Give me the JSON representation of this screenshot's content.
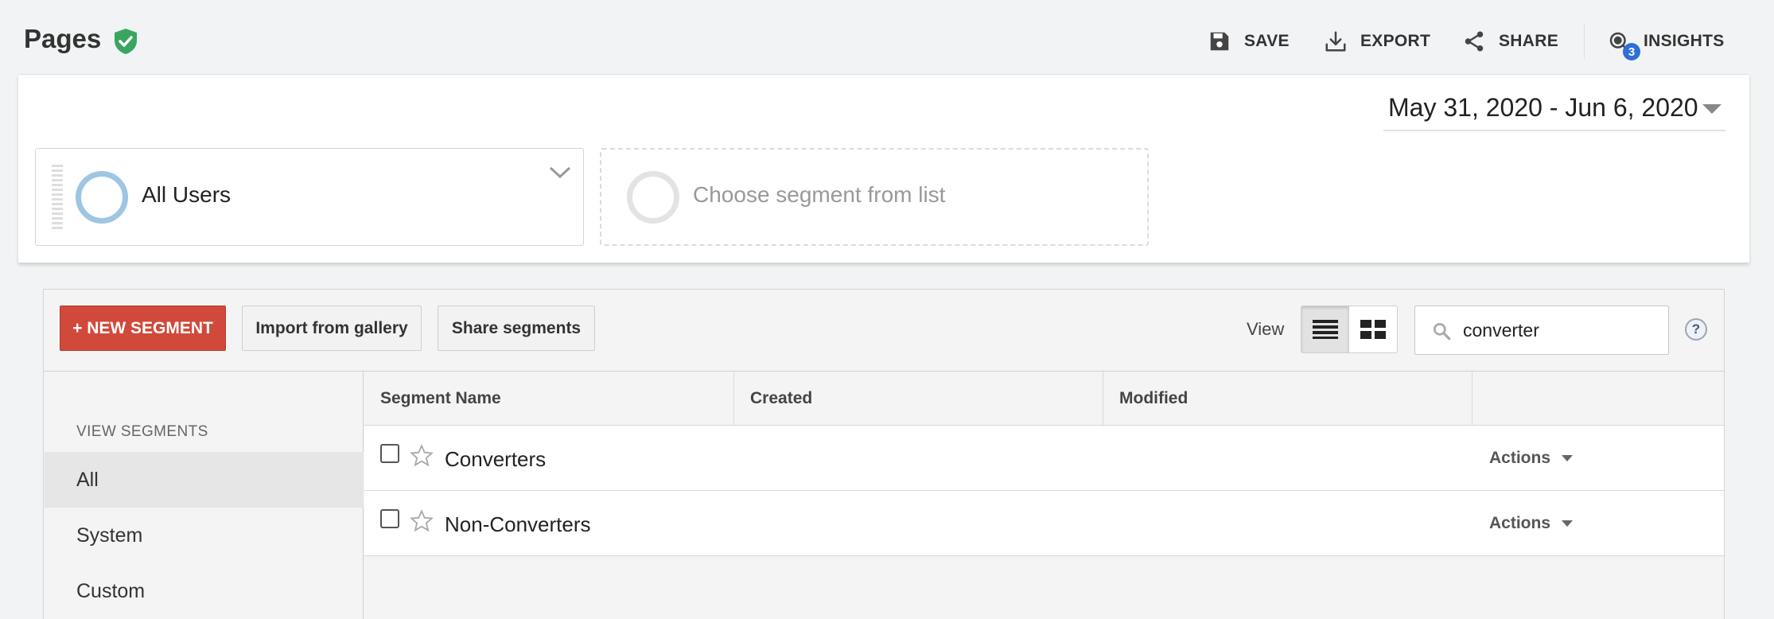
{
  "header": {
    "title": "Pages",
    "save_label": "SAVE",
    "export_label": "EXPORT",
    "share_label": "SHARE",
    "insights_label": "INSIGHTS",
    "insights_count": "3"
  },
  "date_range": "May 31, 2020 - Jun 6, 2020",
  "segments": {
    "active_label": "All Users",
    "empty_label": "Choose segment from list"
  },
  "manager": {
    "new_segment_label": "+ NEW SEGMENT",
    "import_label": "Import from gallery",
    "share_label": "Share segments",
    "view_label": "View",
    "search_value": "converter",
    "help_label": "?"
  },
  "sidebar": {
    "title": "VIEW SEGMENTS",
    "items": [
      {
        "label": "All",
        "selected": true
      },
      {
        "label": "System",
        "selected": false
      },
      {
        "label": "Custom",
        "selected": false
      }
    ]
  },
  "table": {
    "columns": [
      "Segment Name",
      "Created",
      "Modified",
      ""
    ],
    "rows": [
      {
        "name": "Converters",
        "created": "",
        "modified": "",
        "action": "Actions"
      },
      {
        "name": "Non-Converters",
        "created": "",
        "modified": "",
        "action": "Actions"
      }
    ]
  },
  "colors": {
    "new_segment_bg": "#d0493a",
    "shield": "#3aa561",
    "badge": "#2f6fd6",
    "active_ring": "#9ec6e4"
  },
  "icons": {
    "shield": "shield-check-icon",
    "save": "floppy-disk-icon",
    "export": "download-icon",
    "share": "share-nodes-icon",
    "insights": "insights-icon",
    "search": "search-icon",
    "list_view": "list-view-icon",
    "grid_view": "grid-view-icon",
    "star": "star-outline-icon",
    "help": "help-icon"
  }
}
